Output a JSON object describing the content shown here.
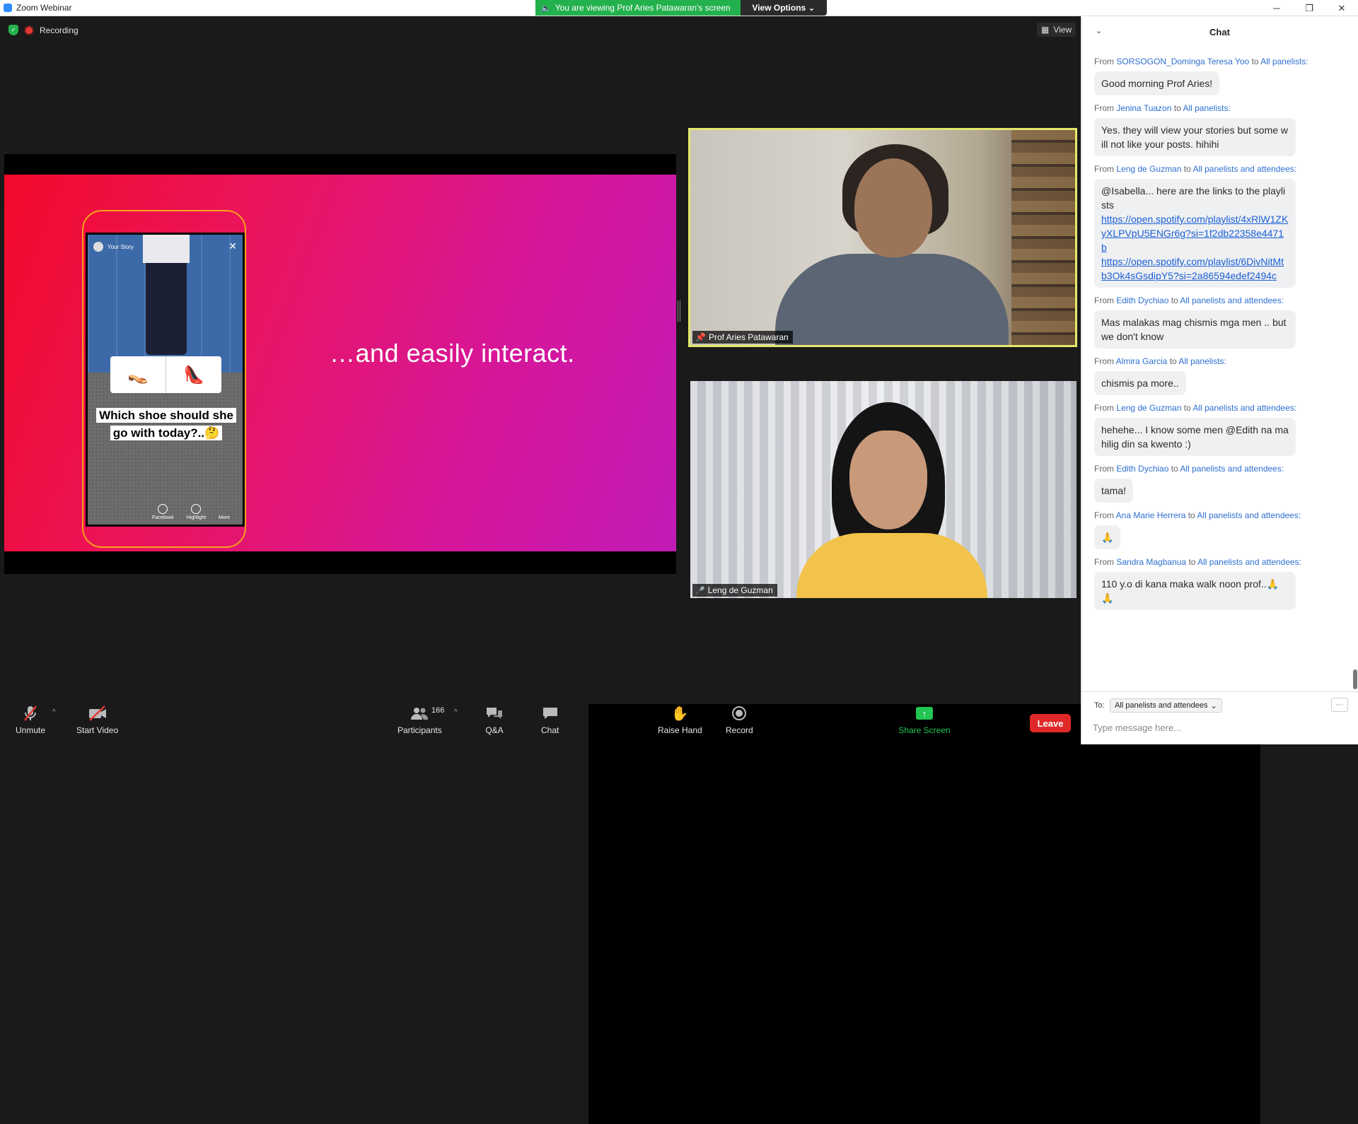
{
  "window": {
    "title": "Zoom Webinar",
    "minimize": "─",
    "maximize": "❐",
    "close": "✕"
  },
  "banner": {
    "viewing_text": "You are viewing Prof Aries Patawaran's screen",
    "view_options": "View Options ⌄"
  },
  "topbar": {
    "recording_label": "Recording",
    "view_label": "View"
  },
  "slide": {
    "headline": "…and easily interact.",
    "story_user": "Your Story",
    "poll_option_1": "👡",
    "poll_option_2": "👠",
    "question": "Which shoe should she go with today?..🤔",
    "icon_labels": [
      "Facebook",
      "Highlight",
      "More"
    ]
  },
  "videos": {
    "speaker_name": "Prof Aries Patawaran",
    "second_name": "Leng de Guzman"
  },
  "toolbar": {
    "unmute": "Unmute",
    "start_video": "Start Video",
    "participants": "Participants",
    "participant_count": "166",
    "qa": "Q&A",
    "chat": "Chat",
    "share_screen": "Share Screen",
    "raise_hand": "Raise Hand",
    "record": "Record",
    "leave": "Leave"
  },
  "chat": {
    "title": "Chat",
    "messages": [
      {
        "from": "SORSOGON_Dominga Teresa Yoo",
        "to": "All panelists:",
        "text": "Good morning Prof Aries!"
      },
      {
        "from": "Jenina Tuazon",
        "to": "All panelists:",
        "text": "Yes. they will view your stories but some will not like your posts. hihihi"
      },
      {
        "from": "Leng de Guzman",
        "to": "All panelists and attendees:",
        "text": "@Isabella... here are the links to the playlists",
        "link1": "https://open.spotify.com/playlist/4xRlW1ZKyXLPVpU5ENGr6g?si=1f2db22358e4471b",
        "link2": "https://open.spotify.com/playlist/6DivNitMtb3Ok4sGsdipY5?si=2a86594edef2494c"
      },
      {
        "from": "Edith Dychiao",
        "to": "All panelists and attendees:",
        "text": "Mas malakas mag chismis mga men .. but we don't know"
      },
      {
        "from": "Almira Garcia",
        "to": "All panelists:",
        "text": "chismis pa more.."
      },
      {
        "from": "Leng de Guzman",
        "to": "All panelists and attendees:",
        "text": "hehehe... I know some men @Edith na mahilig din sa kwento :)"
      },
      {
        "from": "Edith Dychiao",
        "to": "All panelists and attendees:",
        "text": "tama!"
      },
      {
        "from": "Ana Marie Herrera",
        "to": "All panelists and attendees:",
        "text": "🙏"
      },
      {
        "from": "Sandra Magbanua",
        "to": "All panelists and attendees:",
        "text": "110 y.o di kana maka walk noon prof..🙏🙏"
      }
    ],
    "from_word": "From",
    "to_word": "to",
    "to_label": "To:",
    "recipient": "All panelists and attendees",
    "more": "···",
    "input_placeholder": "Type message here..."
  }
}
